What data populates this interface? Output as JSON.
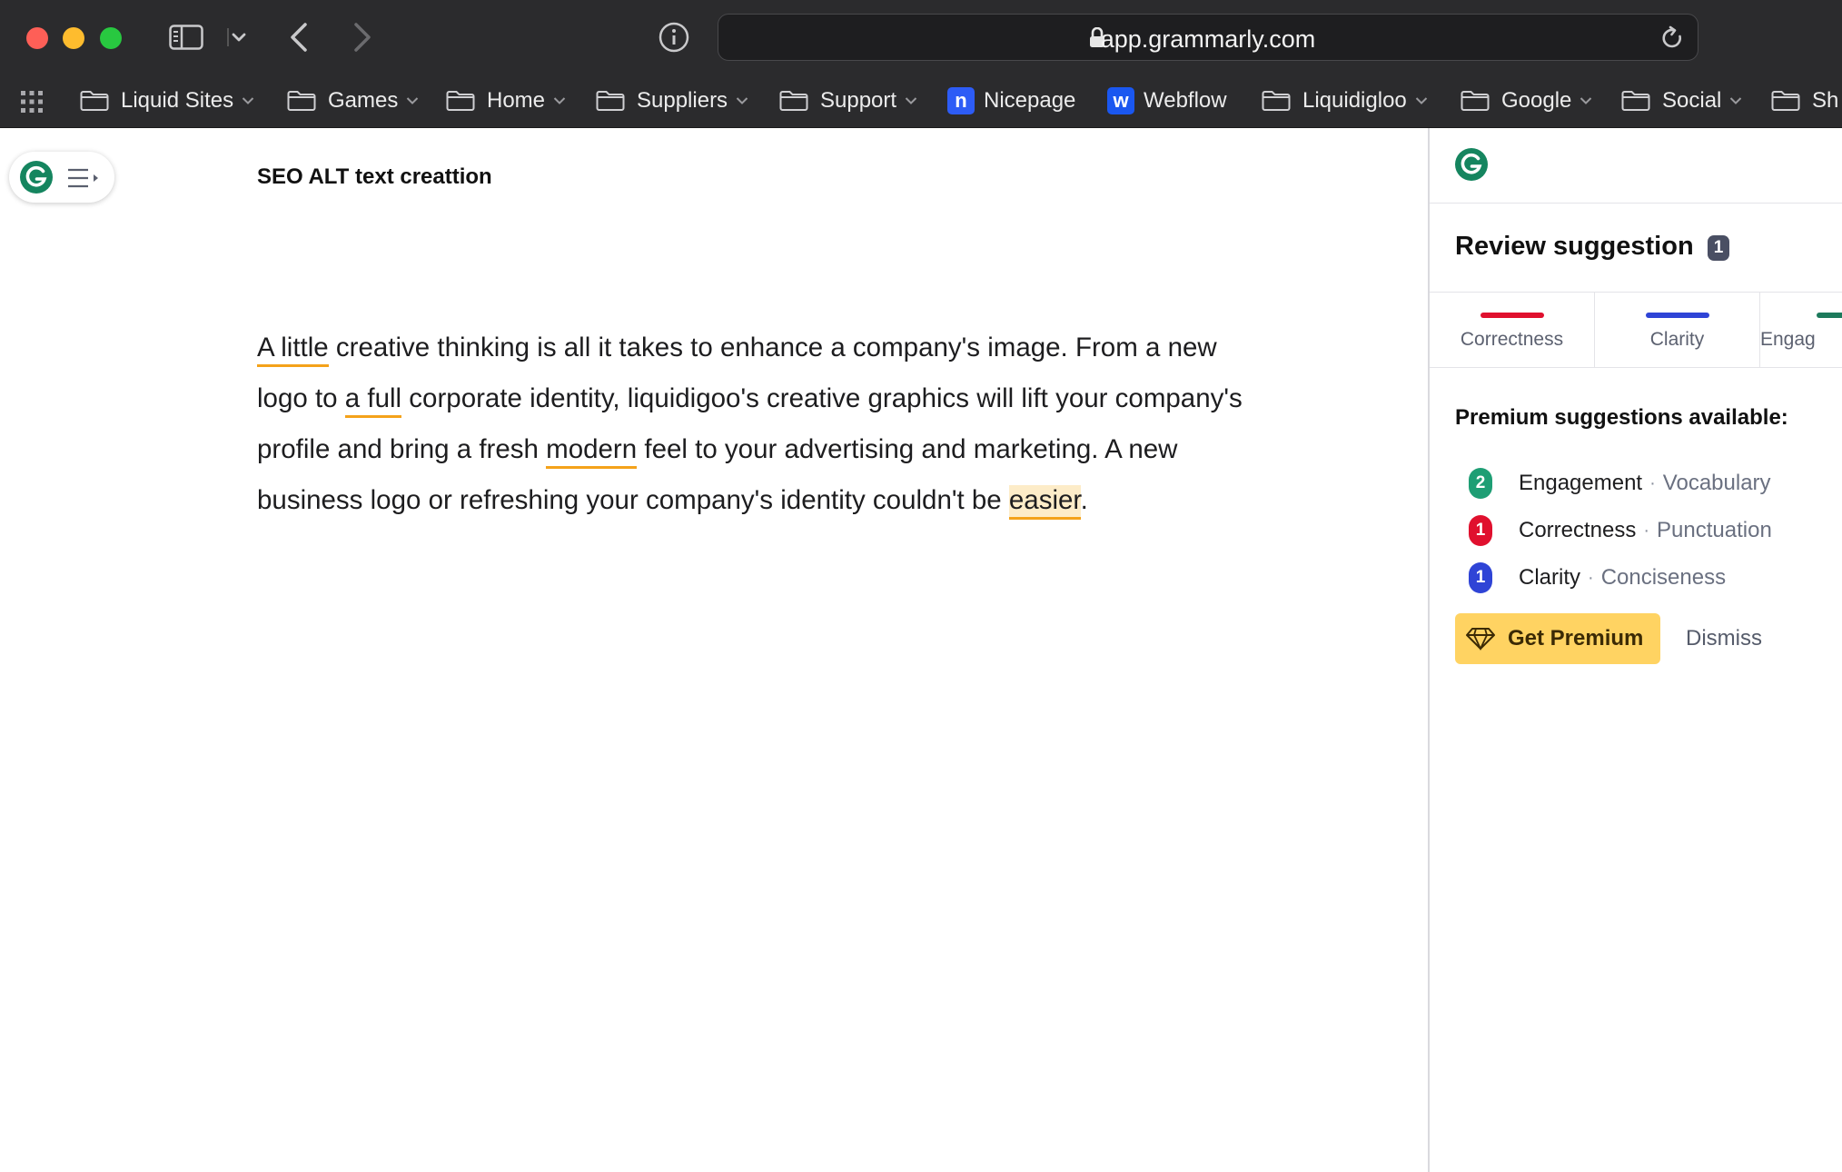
{
  "browser": {
    "url": "app.grammarly.com",
    "bookmarks": [
      {
        "label": "Liquid Sites",
        "type": "folder"
      },
      {
        "label": "Games",
        "type": "folder"
      },
      {
        "label": "Home",
        "type": "folder"
      },
      {
        "label": "Suppliers",
        "type": "folder"
      },
      {
        "label": "Support",
        "type": "folder"
      },
      {
        "label": "Nicepage",
        "type": "site",
        "icon_letter": "n",
        "icon_color": "#2d5cf6"
      },
      {
        "label": "Webflow",
        "type": "site",
        "icon_letter": "w",
        "icon_color": "#1a57f0"
      },
      {
        "label": "Liquidigloo",
        "type": "folder"
      },
      {
        "label": "Google",
        "type": "folder"
      },
      {
        "label": "Social",
        "type": "folder"
      },
      {
        "label": "Sh",
        "type": "folder"
      }
    ]
  },
  "document": {
    "title": "SEO ALT text creattion",
    "body_parts": [
      {
        "text": "A little",
        "flag": "underline"
      },
      {
        "text": " creative thinking is all it takes to enhance a company's image. From a new logo to ",
        "flag": "none"
      },
      {
        "text": "a full",
        "flag": "underline"
      },
      {
        "text": " corporate identity, liquidigoo's creative graphics will lift your company's profile and bring a fresh ",
        "flag": "none"
      },
      {
        "text": "modern",
        "flag": "underline"
      },
      {
        "text": " feel to your advertising and marketing. A new business logo or refreshing your company's identity couldn't be ",
        "flag": "none"
      },
      {
        "text": "easier",
        "flag": "active"
      },
      {
        "text": ".",
        "flag": "none"
      }
    ]
  },
  "panel": {
    "review_title": "Review suggestion",
    "review_count": "1",
    "tabs": [
      {
        "label": "Correctness",
        "color": "#e0102e"
      },
      {
        "label": "Clarity",
        "color": "#2f44d6"
      },
      {
        "label": "Engag",
        "color": "#1d7a5c"
      }
    ],
    "premium_title": "Premium suggestions available:",
    "premium_items": [
      {
        "count": "2",
        "category": "Engagement",
        "sub": "Vocabulary",
        "color": "#1e9e74"
      },
      {
        "count": "1",
        "category": "Correctness",
        "sub": "Punctuation",
        "color": "#e0102e"
      },
      {
        "count": "1",
        "category": "Clarity",
        "sub": "Conciseness",
        "color": "#2f44d6"
      }
    ],
    "get_premium_label": "Get Premium",
    "dismiss_label": "Dismiss",
    "brand_color": "#15c39a"
  }
}
